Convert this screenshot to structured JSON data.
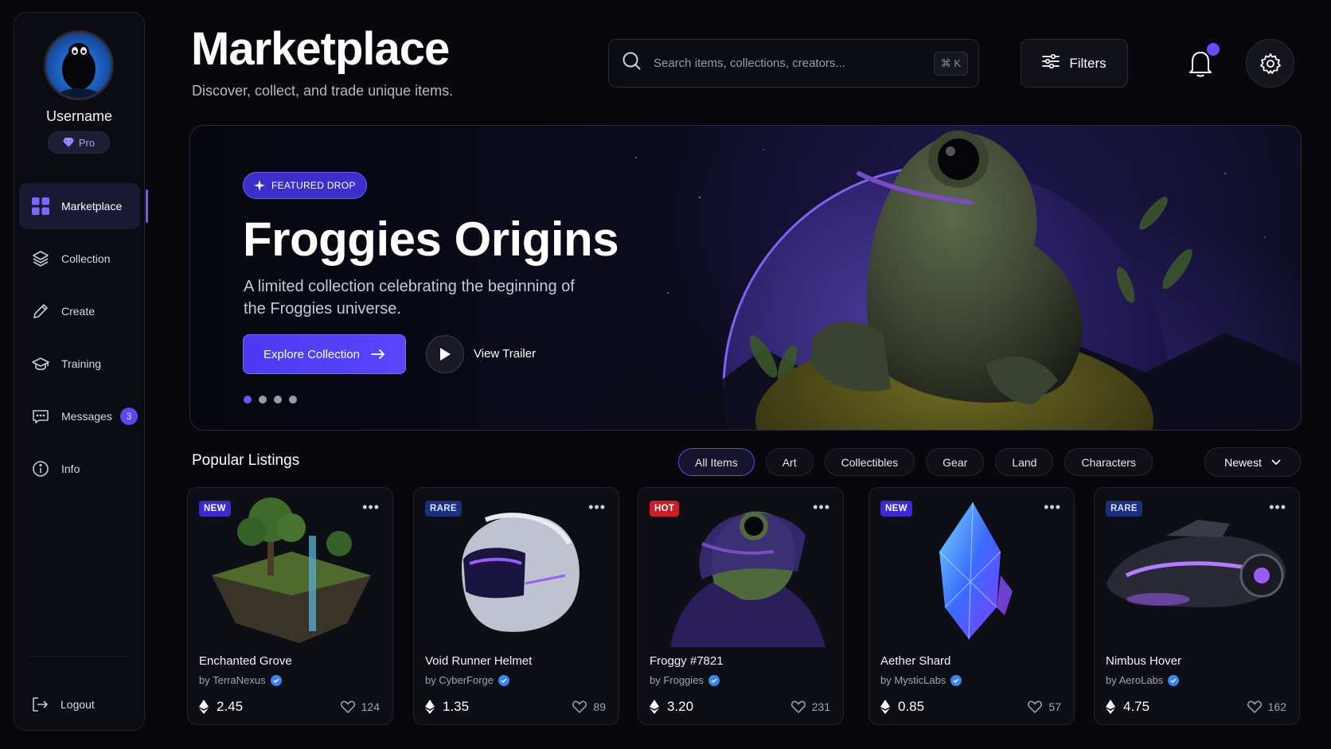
{
  "profile": {
    "username": "Username",
    "tier": "Pro"
  },
  "nav": [
    {
      "label": "Marketplace",
      "icon": "grid-icon",
      "active": true
    },
    {
      "label": "Collection",
      "icon": "layers-icon"
    },
    {
      "label": "Create",
      "icon": "pencil-icon"
    },
    {
      "label": "Training",
      "icon": "graduation-cap-icon"
    },
    {
      "label": "Messages",
      "icon": "chat-icon",
      "count": "3"
    },
    {
      "label": "Info",
      "icon": "info-icon"
    }
  ],
  "logout_label": "Logout",
  "header": {
    "title": "Marketplace",
    "subtitle": "Discover, collect, and trade unique items.",
    "search_placeholder": "Search items, collections, creators...",
    "search_shortcut": "⌘ K",
    "filters_label": "Filters"
  },
  "hero": {
    "pill": "FEATURED DROP",
    "title": "Froggies Origins",
    "description": "A limited collection celebrating the beginning of the Froggies universe.",
    "explore_label": "Explore Collection",
    "trailer_label": "View Trailer",
    "slide_count": 4,
    "active_slide": 1
  },
  "listings": {
    "title": "Popular Listings",
    "tabs": [
      "All Items",
      "Art",
      "Collectibles",
      "Gear",
      "Land",
      "Characters"
    ],
    "active_tab": "All Items",
    "sort": "Newest",
    "items": [
      {
        "badge": "NEW",
        "name": "Enchanted Grove",
        "creator": "by TerraNexus",
        "price": "2.45",
        "likes": "124"
      },
      {
        "badge": "RARE",
        "name": "Void Runner Helmet",
        "creator": "by CyberForge",
        "price": "1.35",
        "likes": "89"
      },
      {
        "badge": "HOT",
        "name": "Froggy #7821",
        "creator": "by Froggies",
        "price": "3.20",
        "likes": "231"
      },
      {
        "badge": "NEW",
        "name": "Aether Shard",
        "creator": "by MysticLabs",
        "price": "0.85",
        "likes": "57"
      },
      {
        "badge": "RARE",
        "name": "Nimbus Hover",
        "creator": "by AeroLabs",
        "price": "4.75",
        "likes": "162"
      }
    ]
  },
  "colors": {
    "accent": "#5b45ff",
    "background": "#07070c",
    "hot": "#c8202a",
    "verified": "#3b82f6"
  }
}
